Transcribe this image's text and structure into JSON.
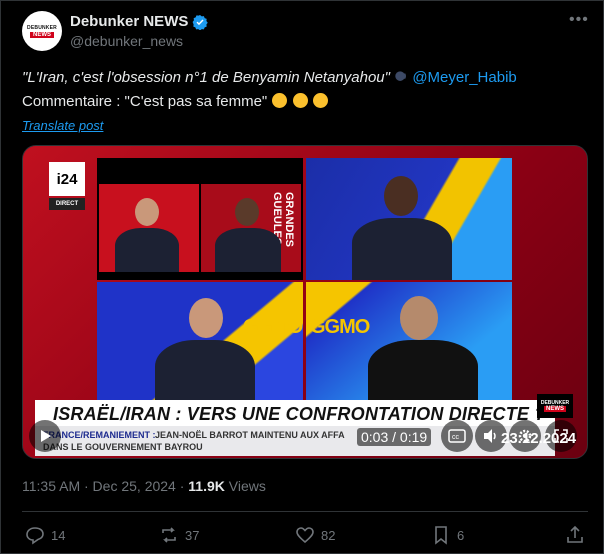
{
  "author": {
    "display_name": "Debunker NEWS",
    "handle": "@debunker_news",
    "avatar_text_top": "DEBUNKER",
    "avatar_text_bottom": "NEWS",
    "verified_color": "#1d9bf0"
  },
  "post": {
    "line1_quote": "\"L'Iran, c'est l'obsession n°1 de Benyamin Netanyahou\"",
    "line1_mention": "@Meyer_Habib",
    "line2": "Commentaire : \"C'est pas sa femme\"",
    "translate": "Translate post"
  },
  "video": {
    "channel_logo": "i24",
    "channel_live": "DIRECT",
    "show_label": "GRANDES GUEULES",
    "set_label": "GGMO",
    "banner_headline": "ISRAËL/IRAN : VERS UNE CONFRONTATION DIRECTE ?",
    "ticker_label": "FRANCE/REMANIEMENT :",
    "ticker_text": "JEAN-NOËL BARROT MAINTENU AUX AFFA",
    "ticker_text2": "DANS LE GOUVERNEMENT BAYROU",
    "watermark_top": "DEBUNKER",
    "watermark_bottom": "NEWS",
    "timecode": "0:03 / 0:19",
    "date_overlay": "23.12.2024"
  },
  "meta": {
    "time": "11:35 AM · Dec 25, 2024 · ",
    "views_count": "11.9K",
    "views_label": " Views"
  },
  "actions": {
    "replies": "14",
    "reposts": "37",
    "likes": "82",
    "bookmarks": "6"
  },
  "colors": {
    "accent": "#1d9bf0",
    "muted": "#71767b",
    "text": "#e7e9ea",
    "background": "#000000"
  }
}
